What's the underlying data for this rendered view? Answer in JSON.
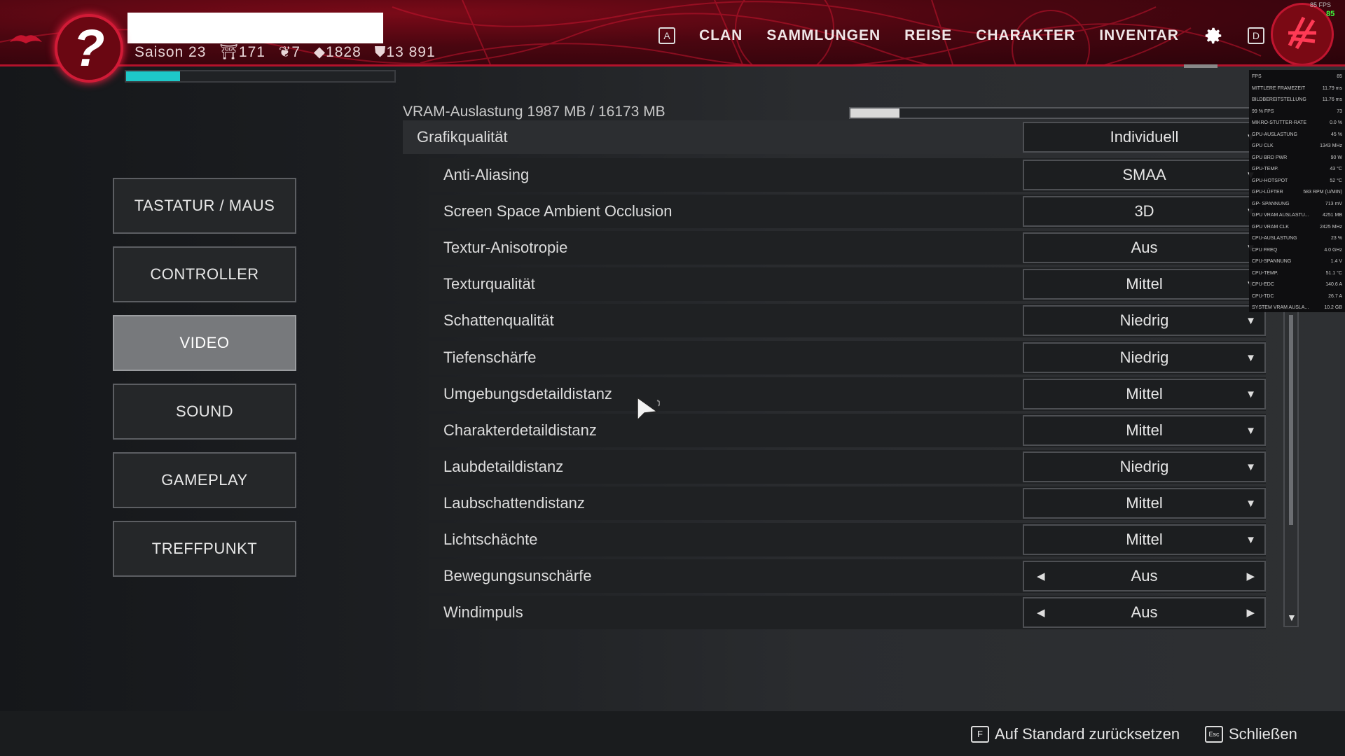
{
  "header": {
    "emblem_glyph": "?",
    "season": "Saison 23",
    "stats": [
      "⛩171",
      "❦7",
      "◆1828",
      "⛊13 891"
    ],
    "xp_fraction": 0.2,
    "nav": [
      {
        "key": "A",
        "label": ""
      },
      {
        "key": "",
        "label": "CLAN"
      },
      {
        "key": "",
        "label": "SAMMLUNGEN"
      },
      {
        "key": "",
        "label": "REISE"
      },
      {
        "key": "",
        "label": "CHARAKTER"
      },
      {
        "key": "",
        "label": "INVENTAR"
      }
    ],
    "nav_key_right": "D",
    "fps_small": "85 FPS",
    "fps_green": "85",
    "accent": "#d11b37"
  },
  "menu": {
    "items": [
      {
        "label": "TASTATUR / MAUS",
        "active": false
      },
      {
        "label": "CONTROLLER",
        "active": false
      },
      {
        "label": "VIDEO",
        "active": true
      },
      {
        "label": "SOUND",
        "active": false
      },
      {
        "label": "GAMEPLAY",
        "active": false
      },
      {
        "label": "TREFFPUNKT",
        "active": false
      }
    ]
  },
  "settings": {
    "vram_label": "VRAM-Auslastung 1987 MB / 16173 MB",
    "vram_fraction": 0.123,
    "quality": {
      "label": "Grafikqualität",
      "value": "Individuell"
    },
    "rows": [
      {
        "label": "Anti-Aliasing",
        "value": "SMAA",
        "control": "dropdown"
      },
      {
        "label": "Screen Space Ambient Occlusion",
        "value": "3D",
        "control": "dropdown"
      },
      {
        "label": "Textur-Anisotropie",
        "value": "Aus",
        "control": "dropdown"
      },
      {
        "label": "Texturqualität",
        "value": "Mittel",
        "control": "dropdown"
      },
      {
        "label": "Schattenqualität",
        "value": "Niedrig",
        "control": "dropdown"
      },
      {
        "label": "Tiefenschärfe",
        "value": "Niedrig",
        "control": "dropdown"
      },
      {
        "label": "Umgebungsdetaildistanz",
        "value": "Mittel",
        "control": "dropdown"
      },
      {
        "label": "Charakterdetaildistanz",
        "value": "Mittel",
        "control": "dropdown"
      },
      {
        "label": "Laubdetaildistanz",
        "value": "Niedrig",
        "control": "dropdown"
      },
      {
        "label": "Laubschattendistanz",
        "value": "Mittel",
        "control": "dropdown"
      },
      {
        "label": "Lichtschächte",
        "value": "Mittel",
        "control": "dropdown"
      },
      {
        "label": "Bewegungsunschärfe",
        "value": "Aus",
        "control": "arrows"
      },
      {
        "label": "Windimpuls",
        "value": "Aus",
        "control": "arrows"
      }
    ]
  },
  "overlay": {
    "rows": [
      {
        "k": "FPS",
        "v": "85"
      },
      {
        "k": "MITTLERE FRAMEZEIT",
        "v": "11.79 ms"
      },
      {
        "k": "BILDBEREITSTELLUNG",
        "v": "11.76 ms"
      },
      {
        "k": "99 % FPS",
        "v": "73"
      },
      {
        "k": "MIKRO-STUTTER-RATE",
        "v": "0.0 %"
      },
      {
        "k": "GPU-AUSLASTUNG",
        "v": "45 %"
      },
      {
        "k": "GPU CLK",
        "v": "1343 MHz"
      },
      {
        "k": "GPU BRD PWR",
        "v": "90 W"
      },
      {
        "k": "GPU-TEMP.",
        "v": "43 °C"
      },
      {
        "k": "GPU-HOTSPOT",
        "v": "52 °C"
      },
      {
        "k": "GPU-LÜFTER",
        "v": "583 RPM (U/MIN)"
      },
      {
        "k": "GP- SPANNUNG",
        "v": "713 mV"
      },
      {
        "k": "GPU VRAM AUSLASTU...",
        "v": "4251 MB"
      },
      {
        "k": "GPU VRAM CLK",
        "v": "2425 MHz"
      },
      {
        "k": "CPU-AUSLASTUNG",
        "v": "23 %"
      },
      {
        "k": "CPU FREQ",
        "v": "4.0 GHz"
      },
      {
        "k": "CPU-SPANNUNG",
        "v": "1.4 V"
      },
      {
        "k": "CPU-TEMP.",
        "v": "51.1 °C"
      },
      {
        "k": "CPU-EDC",
        "v": "140.6 A"
      },
      {
        "k": "CPU-TDC",
        "v": "26.7 A"
      },
      {
        "k": "SYSTEM VRAM AUSLA...",
        "v": "10.2 GB"
      }
    ]
  },
  "footer": {
    "reset_key": "F",
    "reset_label": "Auf Standard zurücksetzen",
    "close_key": "Esc",
    "close_label": "Schließen"
  }
}
